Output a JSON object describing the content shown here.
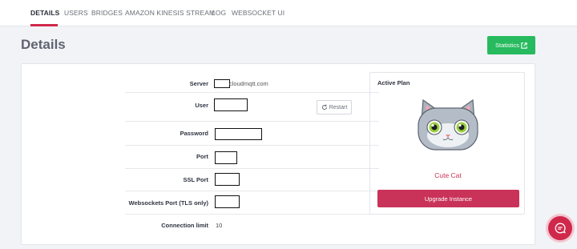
{
  "nav": {
    "tabs": [
      {
        "label": "DETAILS"
      },
      {
        "label": "USERS"
      },
      {
        "label": "BRIDGES"
      },
      {
        "label": "AMAZON KINESIS STREAM"
      },
      {
        "label": "LOG"
      },
      {
        "label": "WEBSOCKET UI"
      }
    ],
    "active_tab": "DETAILS"
  },
  "page": {
    "title": "Details",
    "statistics_button": "Statistics",
    "statistics_icon": "external-link-icon"
  },
  "details": {
    "rows": [
      {
        "label": "Server",
        "value": "cloudmqtt.com"
      },
      {
        "label": "User"
      },
      {
        "label": "Password"
      },
      {
        "label": "Port"
      },
      {
        "label": "SSL Port"
      },
      {
        "label": "Websockets Port (TLS only)"
      },
      {
        "label": "Connection limit",
        "value": "10"
      }
    ],
    "restart_button": "Restart",
    "restart_icon": "refresh-icon"
  },
  "plan": {
    "heading": "Active Plan",
    "name": "Cute Cat",
    "upgrade_button": "Upgrade Instance",
    "mascot_icon": "cat-mascot-icon"
  },
  "chat": {
    "icon": "chat-icon"
  },
  "colors": {
    "accent": "#d0284a",
    "plan_accent": "#c9335a",
    "statistics_green": "#27ba5f",
    "background": "#f2f3f7"
  }
}
